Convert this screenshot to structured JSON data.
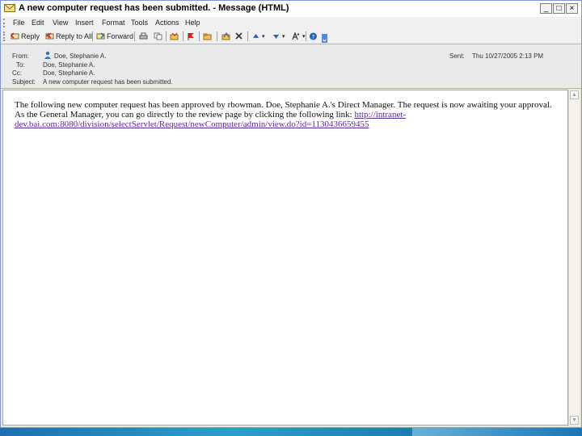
{
  "window": {
    "title": "A new computer request has been submitted. - Message (HTML)",
    "controls": {
      "minimize": "_",
      "maximize": "□",
      "close": "×"
    }
  },
  "menu": [
    "File",
    "Edit",
    "View",
    "Insert",
    "Format",
    "Tools",
    "Actions",
    "Help"
  ],
  "toolbar": {
    "reply": "Reply",
    "reply_all": "Reply to All",
    "forward": "Forward"
  },
  "header": {
    "from_label": "From:",
    "from_value": "Doe, Stephanie A.",
    "to_label": "To:",
    "to_value": "Doe, Stephanie A.",
    "cc_label": "Cc:",
    "cc_value": "Doe, Stephanie A.",
    "subject_label": "Subject:",
    "subject_value": "A new computer request has been submitted.",
    "sent_label": "Sent:",
    "sent_value": "Thu 10/27/2005 2:13 PM"
  },
  "message": {
    "text": "The following new computer request has been approved by rbowman. Doe, Stephanie A.'s Direct Manager. The request is now awaiting your approval. As the General Manager, you can go directly to the review page by clicking the following link: ",
    "link": "http://intranet-dev.bai.com:8080/division/selectServlet/Request/newComputer/admin/view.do?id=1130436659455"
  },
  "colors": {
    "link": "#5a2a9a",
    "window_border": "#7a96df",
    "taskbar": "#1f6fb0"
  }
}
